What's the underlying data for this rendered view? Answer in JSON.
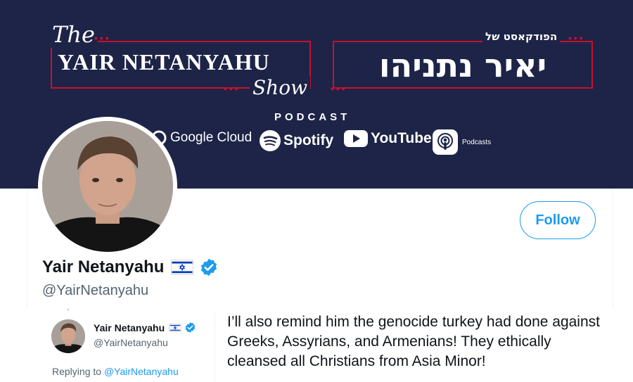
{
  "banner": {
    "show_the": "The",
    "show_title": "YAIR NETANYAHU",
    "show_sub": "Show",
    "hebrew_small": "הפודקאסט של",
    "hebrew_big": "יאיר נתניהו",
    "podcast_label": "PODCAST",
    "platforms": {
      "google": "Google Cloud",
      "spotify": "Spotify",
      "youtube": "YouTube",
      "apple": "Podcasts"
    },
    "colors": {
      "background": "#1d2447",
      "accent": "#c8102e"
    }
  },
  "profile": {
    "name": "Yair Netanyahu",
    "handle": "@YairNetanyahu",
    "follow_label": "Follow",
    "flag_icon": "israel-flag-icon",
    "verified_icon": "verified-badge-icon"
  },
  "reply": {
    "author_name": "Yair Netanyahu",
    "author_handle": "@YairNetanyahu",
    "replying_prefix": "Replying to",
    "replying_to": "@YairNetanyahu",
    "text": "I’ll also remind him the genocide turkey had done against Greeks, Assyrians, and Armenians! They ethically cleansed all Christians from Asia Minor!"
  },
  "colors": {
    "link": "#1d9bf0",
    "secondary_text": "#536471",
    "primary_text": "#0f1419"
  }
}
